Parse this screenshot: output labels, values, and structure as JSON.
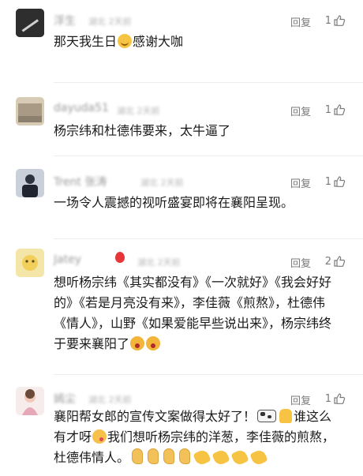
{
  "ui": {
    "reply_label": "回复"
  },
  "comments": [
    {
      "username": "浮生",
      "meta": "湖北 2天前",
      "likes": "1",
      "text": "那天我生日",
      "text_after": "感谢大咖"
    },
    {
      "username": "dayuda51",
      "meta": "湖北 2天前",
      "likes": "1",
      "text": "杨宗纬和杜德伟要来，太牛逼了"
    },
    {
      "username": "Trent 张涛",
      "meta": "湖北 2天前",
      "likes": "1",
      "text": "一场令人震撼的视听盛宴即将在襄阳呈现。"
    },
    {
      "username": "Jatey",
      "meta": "湖北 2天前",
      "likes": "2",
      "text": "想听杨宗纬《其实都没有》《一次就好》《我会好好的》《若是月亮没有来》，李佳薇《煎熬》，杜德伟《情人》，山野《如果爱能早些说出来》，杨宗纬终于要来襄阳了"
    },
    {
      "username": "嫣尘",
      "meta": "湖北 2天前",
      "likes": "1",
      "text": "襄阳帮女郎的宣传文案做得太好了！",
      "text_mid": "谁这么有才呀",
      "text_end": "我们想听杨宗纬的洋葱，李佳薇的煎熬，杜德伟情人。"
    }
  ],
  "icons": {
    "thumb": "thumbs-up-outline-icon",
    "reply": "reply-text"
  },
  "colors": {
    "text": "#1a1a1a",
    "secondary": "#7a7a7a",
    "divider": "#ededed"
  }
}
